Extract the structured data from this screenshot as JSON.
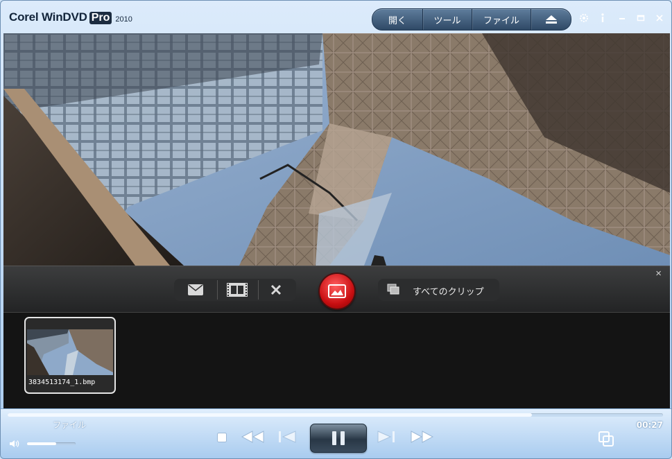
{
  "app": {
    "name": "Corel WinDVD",
    "edition": "Pro",
    "year": "2010"
  },
  "menu": {
    "open": "開く",
    "tools": "ツール",
    "file": "ファイル"
  },
  "window_icons": {
    "settings": "gear-icon",
    "info": "info-icon",
    "minimize": "minimize-icon",
    "maximize": "maximize-icon",
    "close": "close-icon",
    "eject": "eject-icon"
  },
  "snapshot_panel": {
    "all_clips_label": "すべてのクリップ",
    "close_label": "×",
    "clips": [
      {
        "filename": "3834513174_1.bmp"
      }
    ]
  },
  "playback": {
    "source_label": "ファイル",
    "elapsed_time": "00:27",
    "progress": 0.8,
    "volume": 0.6
  },
  "colors": {
    "capture_button": "#c90f12",
    "accent": "#a9cbef"
  }
}
